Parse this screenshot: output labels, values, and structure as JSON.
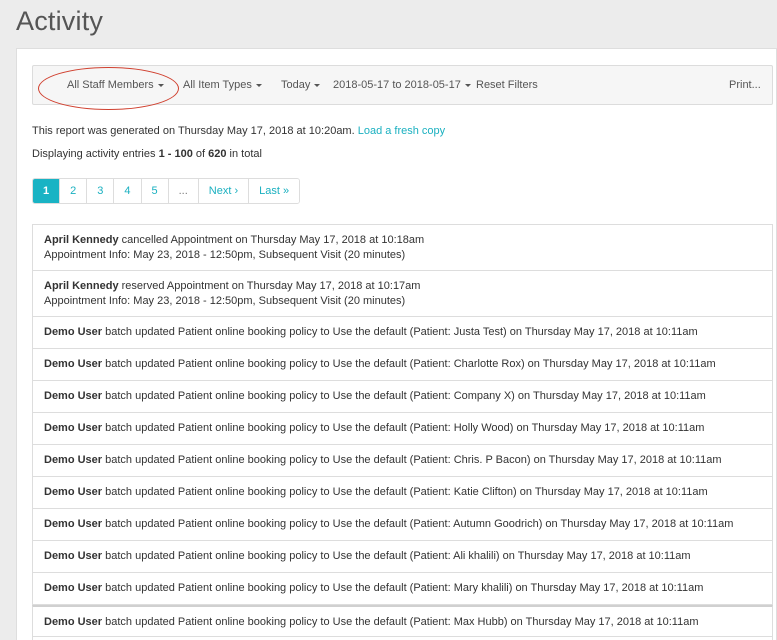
{
  "page": {
    "title": "Activity"
  },
  "filters": {
    "staff": "All Staff Members",
    "item_types": "All Item Types",
    "period": "Today",
    "date_range": "2018-05-17 to 2018-05-17",
    "reset": "Reset Filters",
    "print": "Print..."
  },
  "report": {
    "generated_prefix": "This report was generated on Thursday May 17, 2018 at 10:20am.",
    "fresh_link": "Load a fresh copy",
    "displaying_prefix": "Displaying activity entries",
    "range": "1 - 100",
    "of": "of",
    "total": "620",
    "suffix": "in total"
  },
  "pagination": {
    "pages": [
      "1",
      "2",
      "3",
      "4",
      "5",
      "..."
    ],
    "next": "Next ›",
    "last": "Last »"
  },
  "entries": [
    {
      "user": "April Kennedy",
      "action": "cancelled Appointment on Thursday May 17, 2018 at 10:18am",
      "detail": "Appointment Info: May 23, 2018 - 12:50pm, Subsequent Visit (20 minutes)"
    },
    {
      "user": "April Kennedy",
      "action": "reserved Appointment on Thursday May 17, 2018 at 10:17am",
      "detail": "Appointment Info: May 23, 2018 - 12:50pm, Subsequent Visit (20 minutes)"
    },
    {
      "user": "Demo User",
      "action": "batch updated Patient online booking policy to Use the default (Patient: Justa Test) on Thursday May 17, 2018 at 10:11am"
    },
    {
      "user": "Demo User",
      "action": "batch updated Patient online booking policy to Use the default (Patient: Charlotte Rox) on Thursday May 17, 2018 at 10:11am"
    },
    {
      "user": "Demo User",
      "action": "batch updated Patient online booking policy to Use the default (Patient: Company X) on Thursday May 17, 2018 at 10:11am"
    },
    {
      "user": "Demo User",
      "action": "batch updated Patient online booking policy to Use the default (Patient: Holly Wood) on Thursday May 17, 2018 at 10:11am"
    },
    {
      "user": "Demo User",
      "action": "batch updated Patient online booking policy to Use the default (Patient: Chris. P Bacon) on Thursday May 17, 2018 at 10:11am"
    },
    {
      "user": "Demo User",
      "action": "batch updated Patient online booking policy to Use the default (Patient: Katie Clifton) on Thursday May 17, 2018 at 10:11am"
    },
    {
      "user": "Demo User",
      "action": "batch updated Patient online booking policy to Use the default (Patient: Autumn Goodrich) on Thursday May 17, 2018 at 10:11am"
    },
    {
      "user": "Demo User",
      "action": "batch updated Patient online booking policy to Use the default (Patient: Ali khalili) on Thursday May 17, 2018 at 10:11am"
    },
    {
      "user": "Demo User",
      "action": "batch updated Patient online booking policy to Use the default (Patient: Mary khalili) on Thursday May 17, 2018 at 10:11am"
    },
    {
      "user": "Demo User",
      "action": "batch updated Patient online booking policy to Use the default (Patient: Max Hubb) on Thursday May 17, 2018 at 10:11am"
    },
    {
      "user": "",
      "action": ""
    }
  ]
}
